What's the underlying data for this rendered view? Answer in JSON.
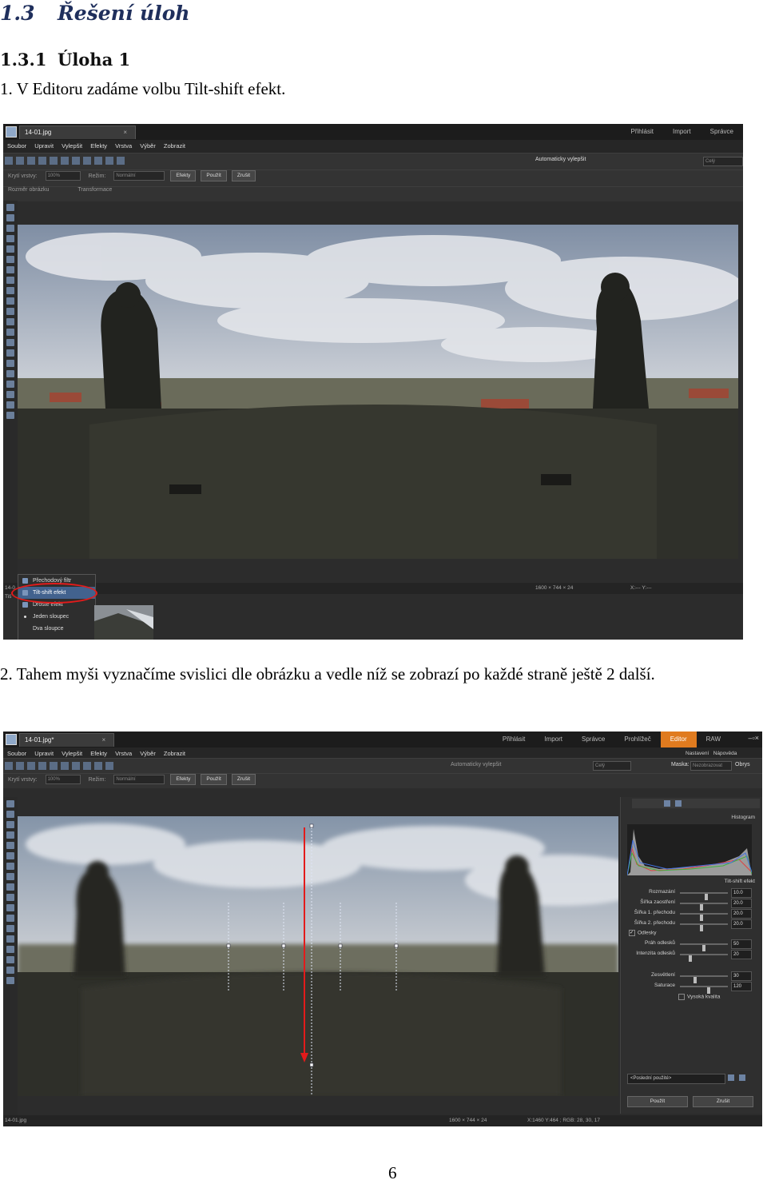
{
  "doc": {
    "section_number": "1.3",
    "section_title": "Řešení úloh",
    "subsection_number": "1.3.1",
    "subsection_title": "Úloha 1",
    "step1": "1. V Editoru zadáme volbu Tilt-shift efekt.",
    "step2": "2. Tahem myši vyznačíme svislici dle obrázku a vedle níž se zobrazí po každé straně ještě 2 další.",
    "page_number": "6"
  },
  "shot1": {
    "tab_title": "14-01.jpg",
    "tab_close": "×",
    "modes": [
      "Přihlásit",
      "Import",
      "Správce"
    ],
    "menu": [
      "Soubor",
      "Upravit",
      "Vylepšit",
      "Efekty",
      "Vrstva",
      "Výběr",
      "Zobrazit"
    ],
    "auto_enhance": "Automaticky vylepšit",
    "zoom_select": "Celý",
    "toolbar2": {
      "layers_label": "Krytí vrstvy:",
      "opacity": "100%",
      "mode_label": "Režim:",
      "mode_value": "Normální",
      "effects_btn": "Efekty",
      "apply_btn": "Použít",
      "cancel_btn": "Zrušit"
    },
    "toolbar3": {
      "img_size_label": "Rozměr obrázku",
      "transform_label": "Transformace"
    },
    "status_left": "14-0",
    "status_size": "1600 × 744 × 24",
    "status_xy": "X:--- Y:---",
    "side_label": "Tiš",
    "dropdown": [
      {
        "label": "Přechodový filtr",
        "selected": false
      },
      {
        "label": "Tilt-shift efekt",
        "selected": true
      },
      {
        "label": "Droste efekt",
        "selected": false
      },
      {
        "label": "Jeden sloupec",
        "selected": false
      },
      {
        "label": "Dva sloupce",
        "selected": false
      }
    ]
  },
  "shot2": {
    "tab_title": "14-01.jpg*",
    "modes": [
      "Přihlásit",
      "Import",
      "Správce",
      "Prohlížeč",
      "Editor",
      "RAW"
    ],
    "active_mode": "Editor",
    "menu": [
      "Soubor",
      "Upravit",
      "Vylepšit",
      "Efekty",
      "Vrstva",
      "Výběr",
      "Zobrazit"
    ],
    "auto_enhance": "Automaticky vylepšit",
    "zoom_select": "Celý",
    "mask_label": "Maska:",
    "mask_value": "Nezobrazovat",
    "outline_label": "Obrys",
    "settings_label": "Nastavení",
    "help_label": "Nápověda",
    "toolbar2": {
      "layers_label": "Krytí vrstvy:",
      "opacity": "100%",
      "mode_label": "Režim:",
      "mode_value": "Normální",
      "effects_btn": "Efekty",
      "apply_btn": "Použít",
      "cancel_btn": "Zrušit"
    },
    "panel": {
      "histogram_label": "Histogram",
      "tiltshift_label": "Tilt-shift efekt",
      "params": [
        {
          "label": "Rozmazání",
          "value": "10.0",
          "level": 0.55
        },
        {
          "label": "Šířka zaostření",
          "value": "20.0",
          "level": 0.45
        },
        {
          "label": "Šířka 1. přechodu",
          "value": "20.0",
          "level": 0.45
        },
        {
          "label": "Šířka 2. přechodu",
          "value": "20.0",
          "level": 0.45
        }
      ],
      "reflections_label": "Odlesky",
      "reflections_checked": true,
      "params2": [
        {
          "label": "Práh odlesků",
          "value": "50",
          "level": 0.5
        },
        {
          "label": "Intenzita odlesků",
          "value": "20",
          "level": 0.2
        }
      ],
      "params3": [
        {
          "label": "Zesvětlení",
          "value": "30",
          "level": 0.3
        },
        {
          "label": "Saturace",
          "value": "120",
          "level": 0.6
        }
      ],
      "high_quality_label": "Vysoká kvalita",
      "preset_label": "<Poslední použité>",
      "apply_btn": "Použít",
      "cancel_btn": "Zrušit"
    },
    "status_left": "14-01.jpg",
    "status_size": "1600 × 744 × 24",
    "status_xy": "X:1460 Y:464 ; RGB: 28, 30, 17"
  }
}
